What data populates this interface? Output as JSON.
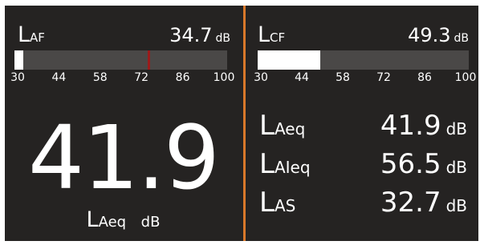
{
  "left_meter": {
    "label_main": "L",
    "label_sub": "AF",
    "value": "34.7",
    "unit": "dB",
    "level_fraction": 0.04,
    "peak_fraction": 0.626,
    "ticks": [
      "30",
      "44",
      "58",
      "72",
      "86",
      "100"
    ]
  },
  "right_meter": {
    "label_main": "L",
    "label_sub": "CF",
    "value": "49.3",
    "unit": "dB",
    "level_fraction": 0.298,
    "ticks": [
      "30",
      "44",
      "58",
      "72",
      "86",
      "100"
    ]
  },
  "big_reading": {
    "value": "41.9",
    "label_main": "L",
    "label_sub": "Aeq",
    "unit": "dB"
  },
  "readings": [
    {
      "label_main": "L",
      "label_sub": "Aeq",
      "value": "41.9",
      "unit": "dB"
    },
    {
      "label_main": "L",
      "label_sub": "AIeq",
      "value": "56.5",
      "unit": "dB"
    },
    {
      "label_main": "L",
      "label_sub": "AS",
      "value": "32.7",
      "unit": "dB"
    }
  ],
  "colors": {
    "panel": "#252322",
    "bar_bg": "#4a4847",
    "fill": "#ffffff",
    "peak": "#9b1b1b",
    "divider": "#d9782a"
  }
}
